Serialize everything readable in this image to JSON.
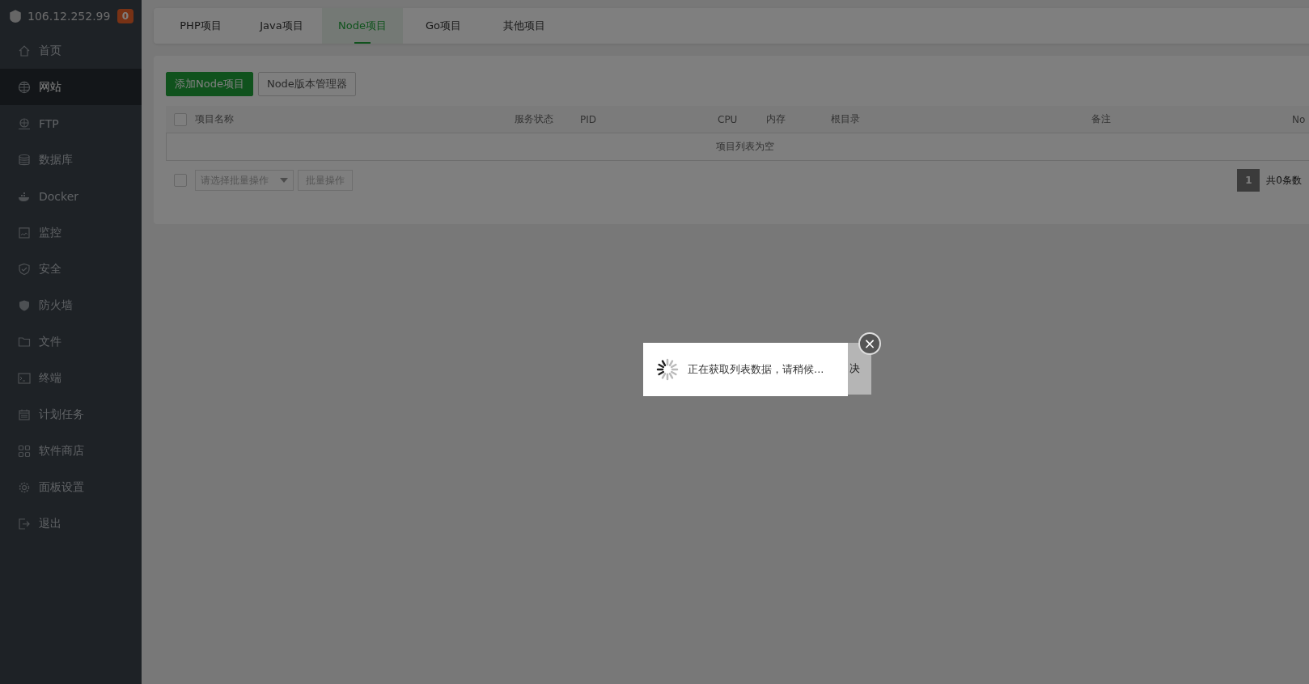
{
  "server": {
    "address": "106.12.252.99",
    "badge": "0"
  },
  "sidebar": {
    "items": [
      {
        "label": "首页",
        "kind": "home",
        "selected": false
      },
      {
        "label": "网站",
        "kind": "globe",
        "selected": true
      },
      {
        "label": "FTP",
        "kind": "ftp",
        "selected": false
      },
      {
        "label": "数据库",
        "kind": "database",
        "selected": false
      },
      {
        "label": "Docker",
        "kind": "docker",
        "selected": false
      },
      {
        "label": "监控",
        "kind": "monitor",
        "selected": false
      },
      {
        "label": "安全",
        "kind": "shield",
        "selected": false
      },
      {
        "label": "防火墙",
        "kind": "firewall",
        "selected": false
      },
      {
        "label": "文件",
        "kind": "folder",
        "selected": false
      },
      {
        "label": "终端",
        "kind": "terminal",
        "selected": false
      },
      {
        "label": "计划任务",
        "kind": "calendar",
        "selected": false
      },
      {
        "label": "软件商店",
        "kind": "apps",
        "selected": false
      },
      {
        "label": "面板设置",
        "kind": "gear",
        "selected": false
      },
      {
        "label": "退出",
        "kind": "logout",
        "selected": false
      }
    ]
  },
  "tabs": [
    {
      "label": "PHP项目",
      "selected": false
    },
    {
      "label": "Java项目",
      "selected": false
    },
    {
      "label": "Node项目",
      "selected": true
    },
    {
      "label": "Go项目",
      "selected": false
    },
    {
      "label": "其他项目",
      "selected": false
    }
  ],
  "toolbar": {
    "add_button": "添加Node项目",
    "version_button": "Node版本管理器"
  },
  "table": {
    "columns": [
      "项目名称",
      "服务状态",
      "PID",
      "CPU",
      "内存",
      "根目录",
      "备注",
      "No"
    ],
    "empty_text": "项目列表为空",
    "select_all_checked": false
  },
  "batch": {
    "checked": false,
    "placeholder": "请选择批量操作",
    "button": "批量操作"
  },
  "pagination": {
    "page": "1",
    "total": "共0条数"
  },
  "dialog": {
    "text_behind": "决",
    "close": "×"
  },
  "loading": {
    "message": "正在获取列表数据，请稍候..."
  }
}
